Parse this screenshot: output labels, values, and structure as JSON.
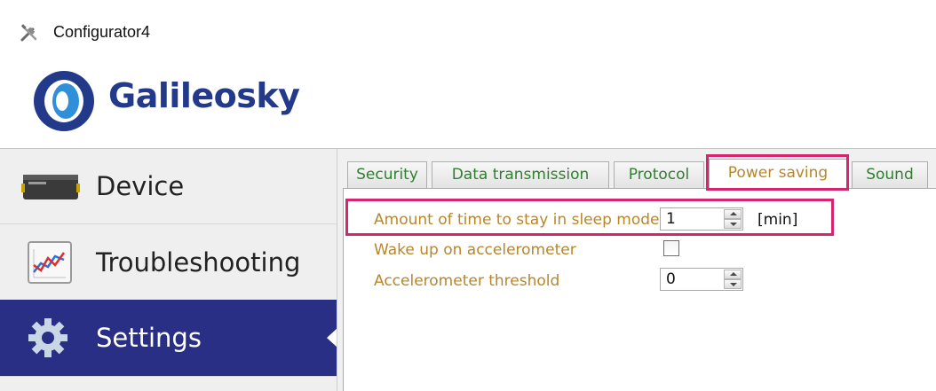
{
  "window": {
    "title": "Configurator4"
  },
  "brand": {
    "name": "Galileosky",
    "color": "#233a8a"
  },
  "sidebar": {
    "active_color": "#2a2f86",
    "items": [
      {
        "label": "Device",
        "icon": "tracker-device-icon"
      },
      {
        "label": "Troubleshooting",
        "icon": "line-chart-icon"
      },
      {
        "label": "Settings",
        "icon": "gear-icon",
        "active": true
      }
    ]
  },
  "tabs": [
    {
      "label": "Security"
    },
    {
      "label": "Data transmission"
    },
    {
      "label": "Protocol"
    },
    {
      "label": "Power saving",
      "active": true
    },
    {
      "label": "Sound"
    }
  ],
  "power_saving": {
    "sleep_time": {
      "label": "Amount of time to stay in sleep mode",
      "value": "1",
      "unit": "[min]"
    },
    "wake_on_accel": {
      "label": "Wake up on accelerometer",
      "checked": false
    },
    "accel_threshold": {
      "label": "Accelerometer threshold",
      "value": "0"
    }
  },
  "colors": {
    "highlight": "#d6246f",
    "label_text": "#b8862a",
    "tab_text": "#2f7f2f"
  }
}
